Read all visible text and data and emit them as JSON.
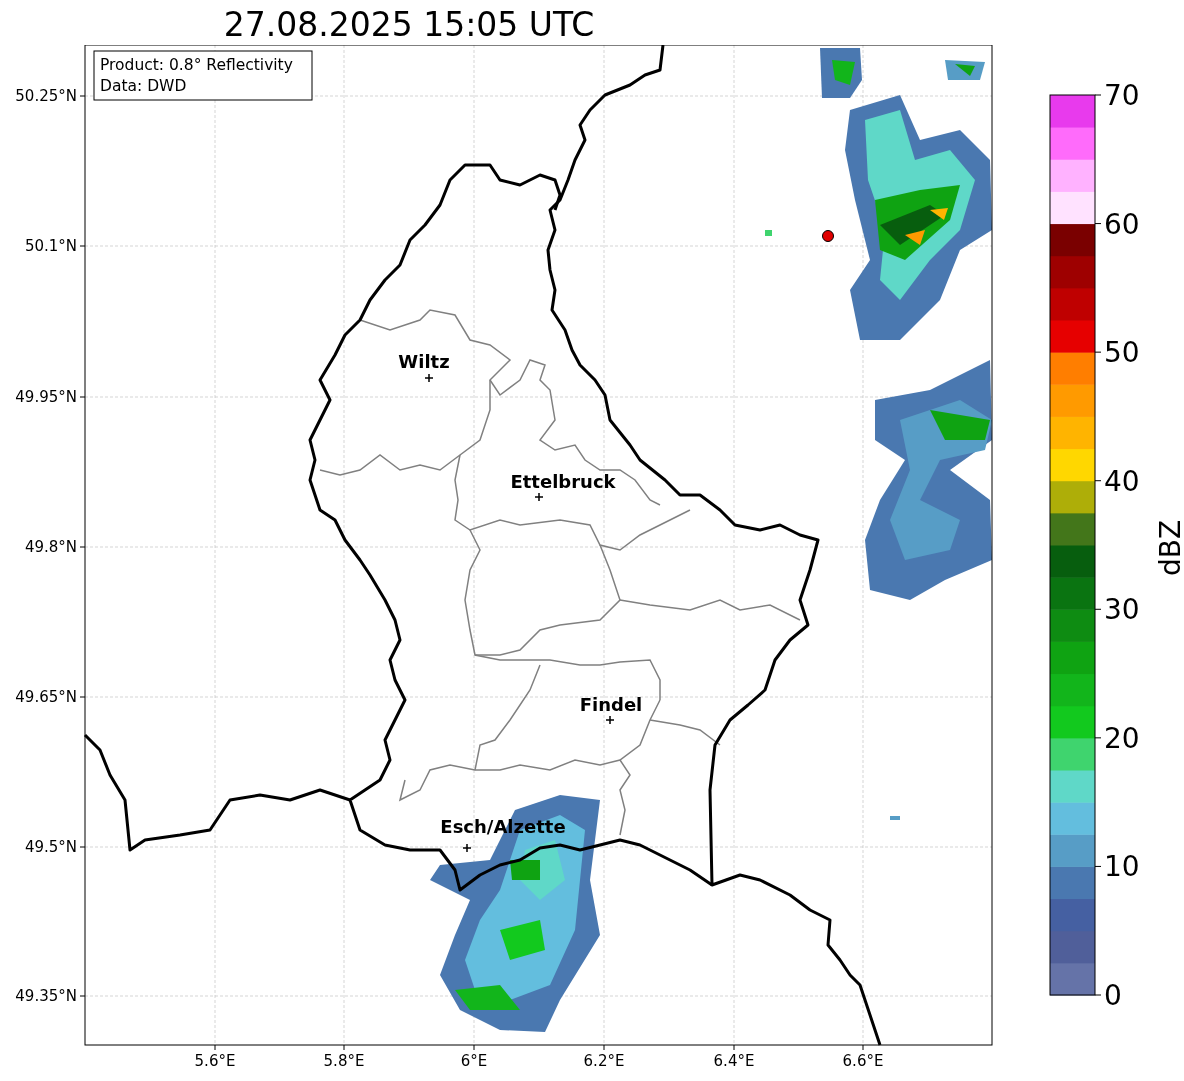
{
  "title": "27.08.2025 15:05 UTC",
  "info_box": [
    "Product: 0.8° Reflectivity",
    "Data: DWD"
  ],
  "map": {
    "lat_ticks": [
      "50.25°N",
      "50.1°N",
      "49.95°N",
      "49.8°N",
      "49.65°N",
      "49.5°N",
      "49.35°N"
    ],
    "lon_ticks": [
      "5.6°E",
      "5.8°E",
      "6°E",
      "6.2°E",
      "6.4°E",
      "6.6°E"
    ],
    "cities": [
      {
        "name": "Wiltz"
      },
      {
        "name": "Ettelbruck"
      },
      {
        "name": "Findel"
      },
      {
        "name": "Esch/Alzette"
      }
    ]
  },
  "colorbar": {
    "label": "dBZ",
    "ticks": [
      "70",
      "60",
      "50",
      "40",
      "30",
      "20",
      "10",
      "0"
    ],
    "bins": [
      {
        "color": "#6573a8"
      },
      {
        "color": "#505f9a"
      },
      {
        "color": "#4560a2"
      },
      {
        "color": "#4a78b0"
      },
      {
        "color": "#579dc6"
      },
      {
        "color": "#63bede"
      },
      {
        "color": "#5fd8c8"
      },
      {
        "color": "#3fd46e"
      },
      {
        "color": "#12c91e"
      },
      {
        "color": "#12b51b"
      },
      {
        "color": "#0fa312"
      },
      {
        "color": "#0e8c12"
      },
      {
        "color": "#0a7411"
      },
      {
        "color": "#075e0e"
      },
      {
        "color": "#43761a"
      },
      {
        "color": "#aeae08"
      },
      {
        "color": "#ffd700"
      },
      {
        "color": "#ffb400"
      },
      {
        "color": "#ff9a00"
      },
      {
        "color": "#ff7e00"
      },
      {
        "color": "#e60000"
      },
      {
        "color": "#bf0000"
      },
      {
        "color": "#9e0000"
      },
      {
        "color": "#7a0000"
      },
      {
        "color": "#ffe2ff"
      },
      {
        "color": "#ffb2ff"
      },
      {
        "color": "#ff6bfb"
      },
      {
        "color": "#e83aed"
      }
    ]
  }
}
